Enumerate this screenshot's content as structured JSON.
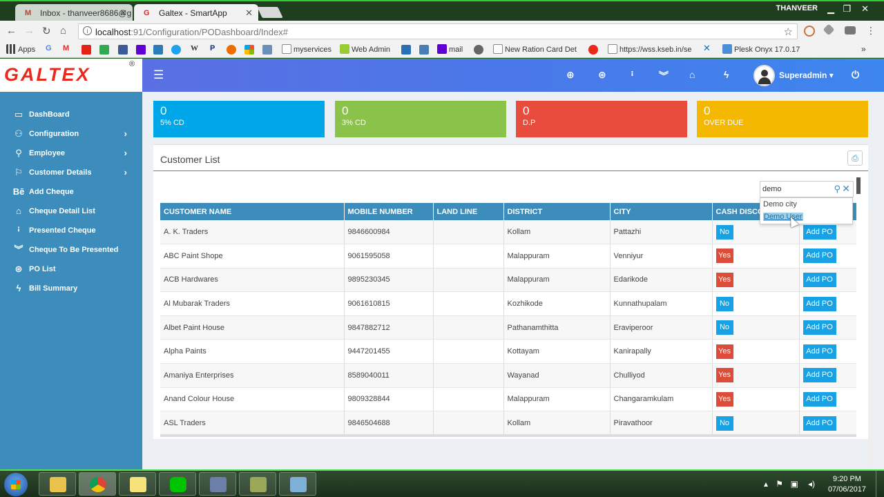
{
  "browser": {
    "tabs": [
      {
        "title": "Inbox - thanveer8686@g",
        "icon": "gmail-icon"
      },
      {
        "title": "Galtex - SmartApp",
        "icon": "galtex-icon"
      }
    ],
    "window_user": "THANVEER",
    "url_host": "localhost",
    "url_path": ":91/Configuration/PODashboard/Index#",
    "bookmarks": [
      "Apps",
      "myservices",
      "Web Admin",
      "mail",
      "New Ration Card Det",
      "https://wss.kseb.in/se",
      "Plesk Onyx 17.0.17"
    ]
  },
  "app": {
    "logo_text": "GALTEX",
    "logo_reg": "®",
    "username": "Superadmin",
    "sidebar": [
      {
        "label": "DashBoard",
        "icon": "monitor-icon",
        "has_children": false
      },
      {
        "label": "Configuration",
        "icon": "group-icon",
        "has_children": true
      },
      {
        "label": "Employee",
        "icon": "search-users-icon",
        "has_children": true
      },
      {
        "label": "Customer Details",
        "icon": "sitemap-icon",
        "has_children": true
      },
      {
        "label": "Add Cheque",
        "icon": "behance-icon",
        "has_children": false
      },
      {
        "label": "Cheque Detail List",
        "icon": "bank-icon",
        "has_children": false
      },
      {
        "label": "Presented Cheque",
        "icon": "key-icon",
        "has_children": false
      },
      {
        "label": "Cheque To Be Presented",
        "icon": "double-chevron-icon",
        "has_children": false
      },
      {
        "label": "PO List",
        "icon": "download-circle-icon",
        "has_children": false
      },
      {
        "label": "Bill Summary",
        "icon": "bolt-icon",
        "has_children": false
      }
    ],
    "stats": [
      {
        "value": "0",
        "label": "5% CD",
        "color": "#00a7e8"
      },
      {
        "value": "0",
        "label": "3% CD",
        "color": "#8bc34a"
      },
      {
        "value": "0",
        "label": "D.P",
        "color": "#e74c3c"
      },
      {
        "value": "0",
        "label": "OVER DUE",
        "color": "#f5b800"
      }
    ],
    "panel_title": "Customer List",
    "search": {
      "value": "demo",
      "suggestions": [
        "Demo city",
        "Demo User"
      ]
    },
    "table": {
      "columns": [
        "CUSTOMER NAME",
        "MOBILE NUMBER",
        "LAND LINE",
        "DISTRICT",
        "CITY",
        "CASH DISCO",
        ""
      ],
      "action_label": "Add PO",
      "rows": [
        {
          "name": "A. K. Traders",
          "mobile": "9846600984",
          "landline": "",
          "district": "Kollam",
          "city": "Pattazhi",
          "cash": "No"
        },
        {
          "name": "ABC Paint Shope",
          "mobile": "9061595058",
          "landline": "",
          "district": "Malappuram",
          "city": "Venniyur",
          "cash": "Yes"
        },
        {
          "name": "ACB Hardwares",
          "mobile": "9895230345",
          "landline": "",
          "district": "Malappuram",
          "city": "Edarikode",
          "cash": "Yes"
        },
        {
          "name": "Al Mubarak Traders",
          "mobile": "9061610815",
          "landline": "",
          "district": "Kozhikode",
          "city": "Kunnathupalam",
          "cash": "No"
        },
        {
          "name": "Albet Paint House",
          "mobile": "9847882712",
          "landline": "",
          "district": "Pathanamthitta",
          "city": "Eraviperoor",
          "cash": "No"
        },
        {
          "name": "Alpha Paints",
          "mobile": "9447201455",
          "landline": "",
          "district": "Kottayam",
          "city": "Kanirapally",
          "cash": "Yes"
        },
        {
          "name": "Amaniya Enterprises",
          "mobile": "8589040011",
          "landline": "",
          "district": "Wayanad",
          "city": "Chulliyod",
          "cash": "Yes"
        },
        {
          "name": "Anand Colour House",
          "mobile": "9809328844",
          "landline": "",
          "district": "Malappuram",
          "city": "Changaramkulam",
          "cash": "Yes"
        },
        {
          "name": "ASL Traders",
          "mobile": "9846504688",
          "landline": "",
          "district": "Kollam",
          "city": "Piravathoor",
          "cash": "No"
        }
      ]
    }
  },
  "taskbar": {
    "time": "9:20 PM",
    "date": "07/06/2017"
  }
}
